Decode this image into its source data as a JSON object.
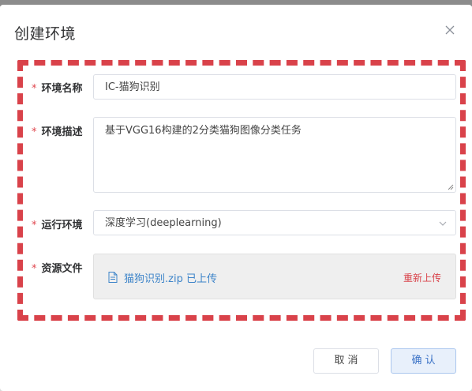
{
  "dialog": {
    "title": "创建环境",
    "close_icon": "close-icon"
  },
  "form": {
    "required_mark": "*",
    "name": {
      "label": "环境名称",
      "value": "IC-猫狗识别"
    },
    "description": {
      "label": "环境描述",
      "value": "基于VGG16构建的2分类猫狗图像分类任务"
    },
    "runtime": {
      "label": "运行环境",
      "value": "深度学习(deeplearning)",
      "icon": "chevron-down-icon"
    },
    "resource": {
      "label": "资源文件",
      "file_text": "猫狗识别.zip 已上传",
      "file_icon": "document-icon",
      "reupload_label": "重新上传"
    }
  },
  "footer": {
    "cancel_label": "取消",
    "confirm_label": "确认"
  },
  "colors": {
    "required": "#e0484f",
    "dashed_frame": "#d9424a",
    "file_link": "#3d84c9",
    "reupload": "#d9424a",
    "confirm_text": "#3d74c7"
  }
}
